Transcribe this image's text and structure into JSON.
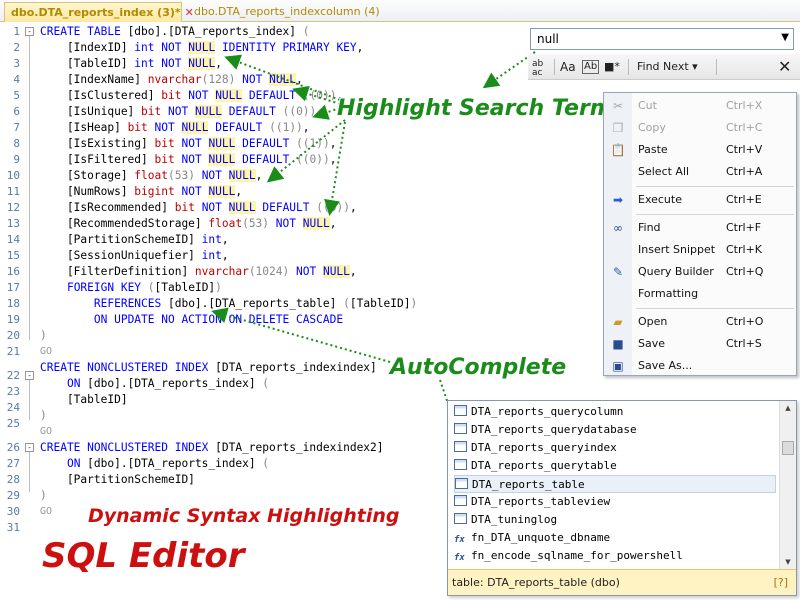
{
  "tabs": [
    {
      "label": "dbo.DTA_reports_index (3)*",
      "close": "✕"
    },
    {
      "label": "dbo.DTA_reports_indexcolumn (4)"
    }
  ],
  "line_numbers": [
    "1",
    "2",
    "3",
    "4",
    "5",
    "6",
    "7",
    "8",
    "9",
    "10",
    "11",
    "12",
    "13",
    "14",
    "15",
    "16",
    "17",
    "18",
    "19",
    "20",
    "21",
    "22",
    "23",
    "24",
    "25",
    "26",
    "27",
    "28",
    "29",
    "30",
    "31"
  ],
  "go_keyword": "GO",
  "search": {
    "value": "null",
    "find_next_label": "Find Next",
    "toolbar_icons": [
      "match-whole-word-icon",
      "match-case-icon",
      "regex-icon",
      "highlight-icon",
      "close-icon"
    ]
  },
  "annotations": {
    "highlight_search_terms": "Highlight Search Terms",
    "autocomplete": "AutoComplete",
    "dynamic_syntax": "Dynamic Syntax Highlighting",
    "sql_editor": "SQL Editor"
  },
  "context_menu": [
    {
      "label": "Cut",
      "shortcut": "Ctrl+X",
      "icon": "scissors-icon",
      "disabled": true
    },
    {
      "label": "Copy",
      "shortcut": "Ctrl+C",
      "icon": "copy-icon",
      "disabled": true
    },
    {
      "label": "Paste",
      "shortcut": "Ctrl+V",
      "icon": "paste-icon",
      "disabled": false
    },
    {
      "label": "Select All",
      "shortcut": "Ctrl+A",
      "icon": "",
      "disabled": false
    },
    {
      "label": "Execute",
      "shortcut": "Ctrl+E",
      "icon": "execute-arrow-icon",
      "disabled": false
    },
    {
      "label": "Find",
      "shortcut": "Ctrl+F",
      "icon": "binoculars-icon",
      "disabled": false
    },
    {
      "label": "Insert Snippet",
      "shortcut": "Ctrl+K",
      "icon": "",
      "disabled": false
    },
    {
      "label": "Query Builder",
      "shortcut": "Ctrl+Q",
      "icon": "query-builder-icon",
      "disabled": false
    },
    {
      "label": "Formatting",
      "shortcut": "",
      "icon": "",
      "disabled": false
    },
    {
      "label": "Open",
      "shortcut": "Ctrl+O",
      "icon": "folder-open-icon",
      "disabled": false
    },
    {
      "label": "Save",
      "shortcut": "Ctrl+S",
      "icon": "floppy-disk-icon",
      "disabled": false
    },
    {
      "label": "Save As...",
      "shortcut": "",
      "icon": "save-as-icon",
      "disabled": false
    }
  ],
  "autocomplete": {
    "items": [
      {
        "label": "DTA_reports_querycolumn",
        "kind": "table"
      },
      {
        "label": "DTA_reports_querydatabase",
        "kind": "table"
      },
      {
        "label": "DTA_reports_queryindex",
        "kind": "table"
      },
      {
        "label": "DTA_reports_querytable",
        "kind": "table"
      },
      {
        "label": "DTA_reports_table",
        "kind": "table",
        "selected": true
      },
      {
        "label": "DTA_reports_tableview",
        "kind": "table"
      },
      {
        "label": "DTA_tuninglog",
        "kind": "table"
      },
      {
        "label": "fn_DTA_unquote_dbname",
        "kind": "function"
      },
      {
        "label": "fn_encode_sqlname_for_powershell",
        "kind": "function"
      }
    ],
    "status": "table: DTA_reports_table (dbo)",
    "help": "[?]"
  },
  "colors": {
    "keyword": "#0000ff",
    "type": "#c00000",
    "highlight": "#fff5a8",
    "annotation_green": "#1a8c1a",
    "annotation_red": "#cc1010"
  }
}
